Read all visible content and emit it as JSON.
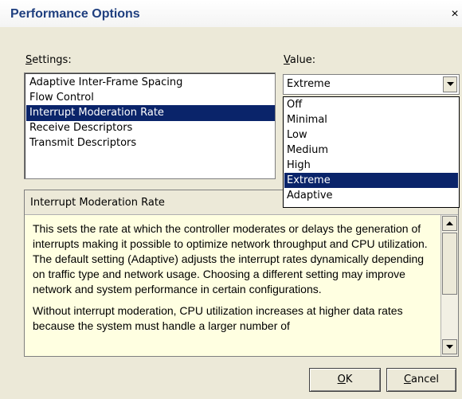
{
  "dialog": {
    "title": "Performance Options",
    "close_glyph": "×"
  },
  "settings": {
    "label_prefix": "",
    "label_accel": "S",
    "label_rest": "ettings:",
    "items": [
      {
        "label": "Adaptive Inter-Frame Spacing"
      },
      {
        "label": "Flow Control"
      },
      {
        "label": "Interrupt Moderation Rate"
      },
      {
        "label": "Receive Descriptors"
      },
      {
        "label": "Transmit Descriptors"
      }
    ],
    "selected_label": "Interrupt Moderation Rate"
  },
  "value": {
    "label_accel": "V",
    "label_rest": "alue:",
    "selected": "Extreme",
    "options": [
      {
        "label": "Off"
      },
      {
        "label": "Minimal"
      },
      {
        "label": "Low"
      },
      {
        "label": "Medium"
      },
      {
        "label": "High"
      },
      {
        "label": "Extreme"
      },
      {
        "label": "Adaptive"
      }
    ]
  },
  "description": {
    "title": "Interrupt Moderation Rate",
    "paragraphs": [
      "This sets the rate at which the controller moderates or delays the generation of interrupts making it possible to optimize network throughput and CPU utilization. The default setting (Adaptive) adjusts the interrupt rates dynamically depending on traffic type and network usage. Choosing a different setting may improve network and system performance in certain configurations.",
      "Without interrupt moderation, CPU utilization increases at higher data rates because the system must handle a larger number of"
    ]
  },
  "buttons": {
    "ok_accel": "O",
    "ok_rest": "K",
    "cancel_accel": "C",
    "cancel_rest": "ancel"
  },
  "colors": {
    "highlight": "#0a246a",
    "info_background": "#ffffe1",
    "title_text": "#1f3f7f"
  }
}
